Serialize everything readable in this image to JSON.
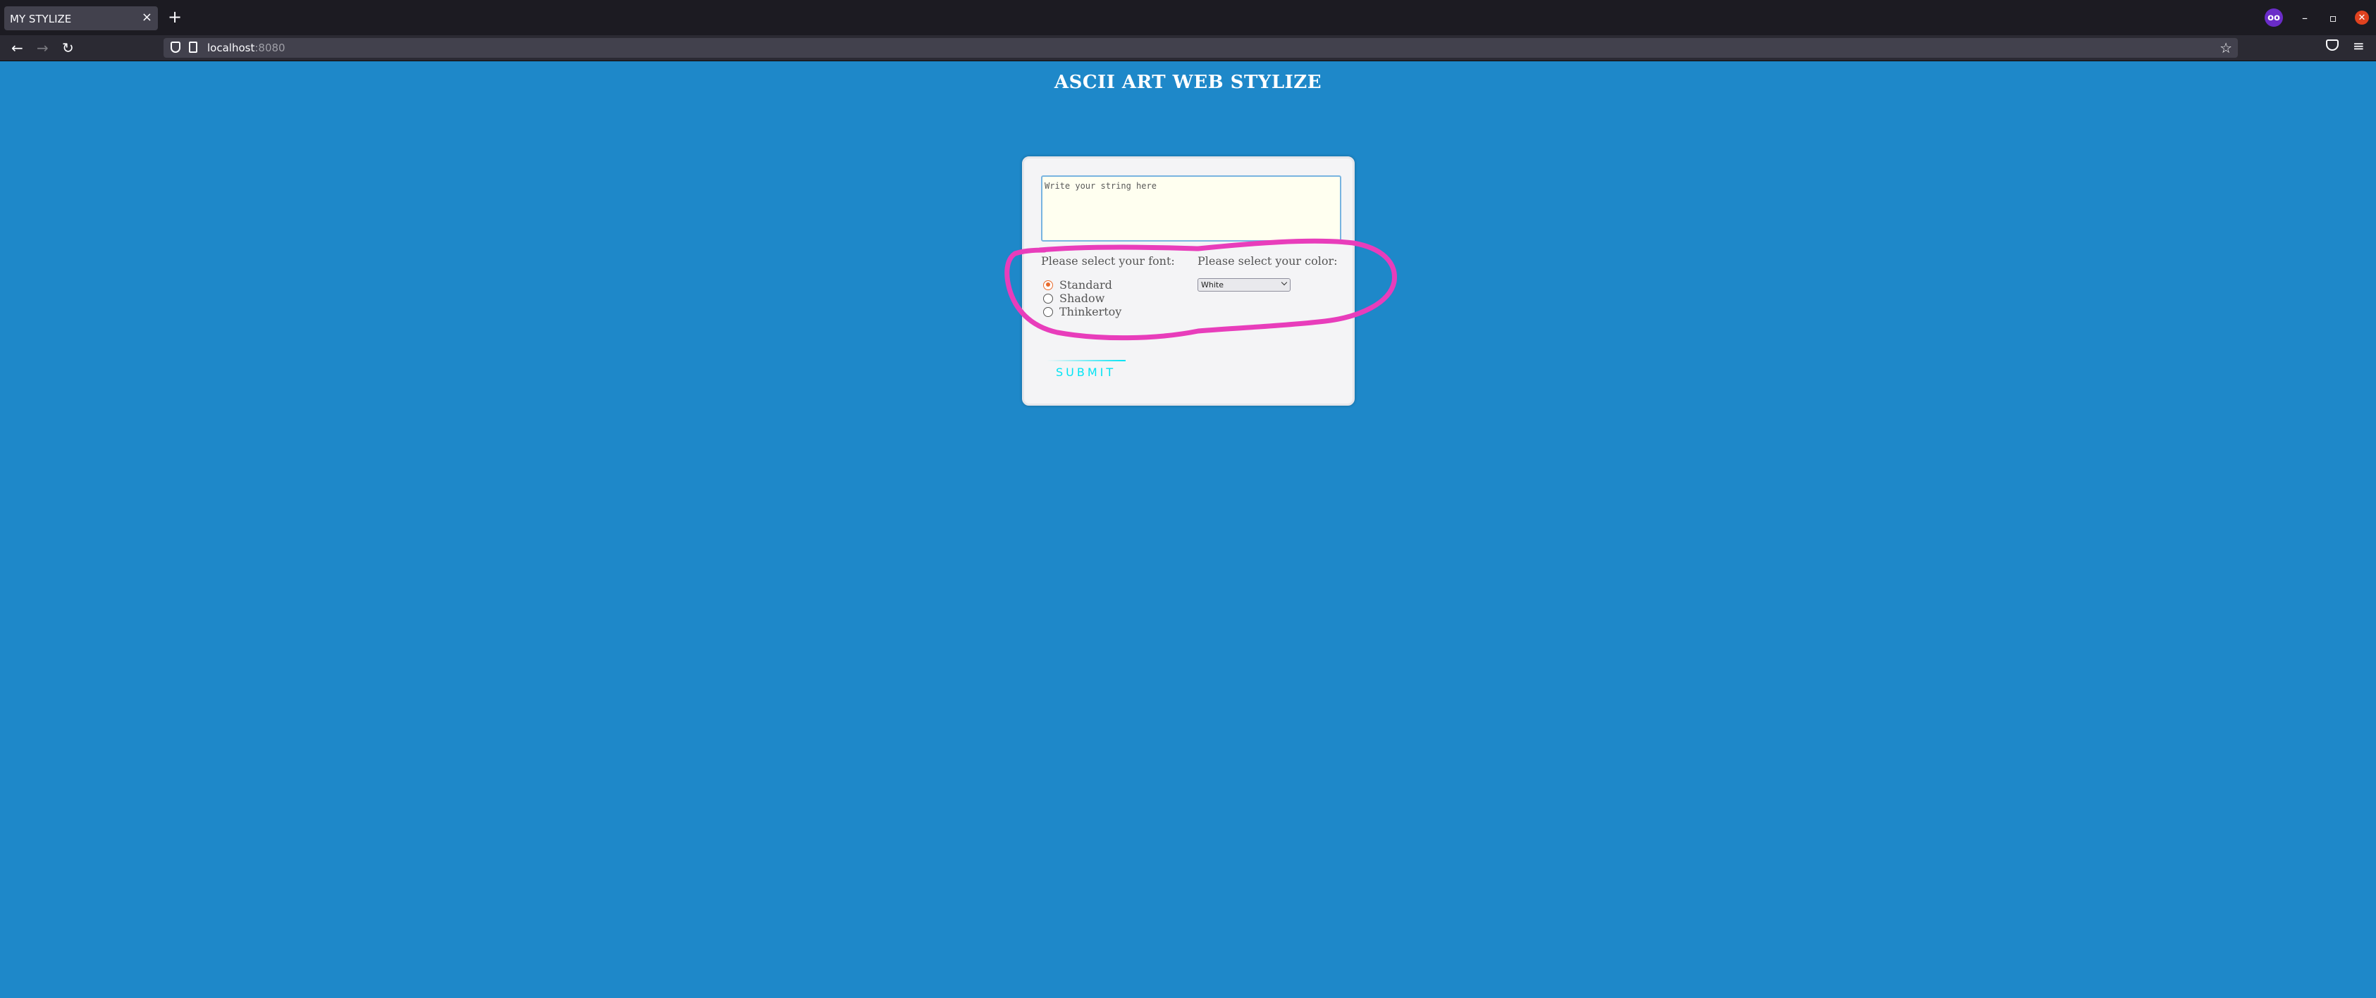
{
  "browser": {
    "tab_title": "MY STYLIZE",
    "tab_close": "×",
    "new_tab": "+",
    "url_host": "localhost",
    "url_port": ":8080",
    "profile_icon_text": "oo"
  },
  "page": {
    "title": "ASCII ART WEB STYLIZE",
    "input_placeholder": "Write your string here",
    "font_label": "Please select your font:",
    "color_label": "Please select your color:",
    "fonts": [
      {
        "label": "Standard",
        "checked": true
      },
      {
        "label": "Shadow",
        "checked": false
      },
      {
        "label": "Thinkertoy",
        "checked": false
      }
    ],
    "selected_color": "White",
    "submit_label": "SUBMIT"
  },
  "colors": {
    "page_background": "#1e88c9",
    "annotation": "#e83dbb",
    "submit_accent": "#03e4f4",
    "radio_checked": "#e86a2c"
  }
}
